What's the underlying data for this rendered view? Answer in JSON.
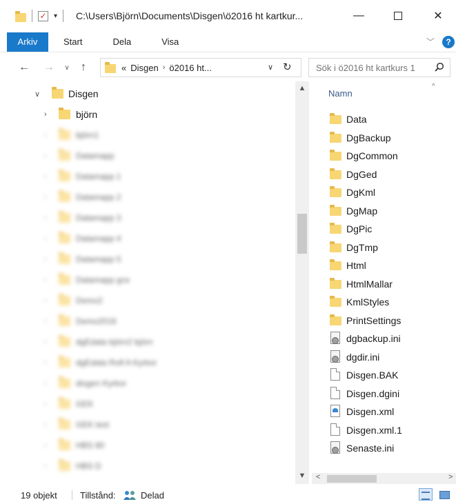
{
  "window": {
    "title": "C:\\Users\\Björn\\Documents\\Disgen\\ö2016 ht kartkur...",
    "minimize_glyph": "—",
    "close_glyph": "✕"
  },
  "quick_access": {
    "dropdown_glyph": "▾"
  },
  "ribbon": {
    "tabs": [
      "Arkiv",
      "Start",
      "Dela",
      "Visa"
    ],
    "collapse_glyph": "﹀",
    "help_glyph": "?"
  },
  "navigation": {
    "back_glyph": "←",
    "forward_glyph": "→",
    "recent_glyph": "∨",
    "up_glyph": "↑"
  },
  "address_bar": {
    "overflow": "«",
    "crumbs": [
      "Disgen",
      "ö2016 ht..."
    ],
    "separator": "›",
    "dropdown_glyph": "∨",
    "refresh_glyph": "↻"
  },
  "search": {
    "placeholder": "Sök i ö2016 ht kartkurs 1"
  },
  "tree": {
    "root": {
      "label": "Disgen",
      "chevron": "∨"
    },
    "child": {
      "label": "björn",
      "chevron": "›"
    },
    "blurred_items": [
      "björn1",
      "Datamapp",
      "Datamapp 1",
      "Datamapp 2",
      "Datamapp 3",
      "Datamapp 4",
      "Datamapp 5",
      "Datamapp gce",
      "Demo2",
      "Demo2016",
      "dgEdata björn2 björn",
      "dgEdata Rolf A Kyrkor",
      "disgen Kyrkor",
      "GEK",
      "GEK test",
      "HBS 80",
      "HBS D"
    ],
    "blurred_chevron": "›"
  },
  "nav_scrollbar": {
    "up_glyph": "▲",
    "down_glyph": "▼"
  },
  "file_list": {
    "column_header": "Namn",
    "sort_glyph": "^",
    "items": [
      {
        "name": "Data",
        "kind": "folder"
      },
      {
        "name": "DgBackup",
        "kind": "folder"
      },
      {
        "name": "DgCommon",
        "kind": "folder"
      },
      {
        "name": "DgGed",
        "kind": "folder"
      },
      {
        "name": "DgKml",
        "kind": "folder"
      },
      {
        "name": "DgMap",
        "kind": "folder"
      },
      {
        "name": "DgPic",
        "kind": "folder"
      },
      {
        "name": "DgTmp",
        "kind": "folder"
      },
      {
        "name": "Html",
        "kind": "folder"
      },
      {
        "name": "HtmlMallar",
        "kind": "folder"
      },
      {
        "name": "KmlStyles",
        "kind": "folder"
      },
      {
        "name": "PrintSettings",
        "kind": "folder"
      },
      {
        "name": "dgbackup.ini",
        "kind": "ini"
      },
      {
        "name": "dgdir.ini",
        "kind": "ini"
      },
      {
        "name": "Disgen.BAK",
        "kind": "doc"
      },
      {
        "name": "Disgen.dgini",
        "kind": "doc"
      },
      {
        "name": "Disgen.xml",
        "kind": "xml"
      },
      {
        "name": "Disgen.xml.1",
        "kind": "doc"
      },
      {
        "name": "Senaste.ini",
        "kind": "ini"
      }
    ]
  },
  "hscroll": {
    "left_glyph": "<",
    "right_glyph": ">"
  },
  "status": {
    "count": "19 objekt",
    "state_label": "Tillstånd:",
    "shared": "Delad"
  }
}
